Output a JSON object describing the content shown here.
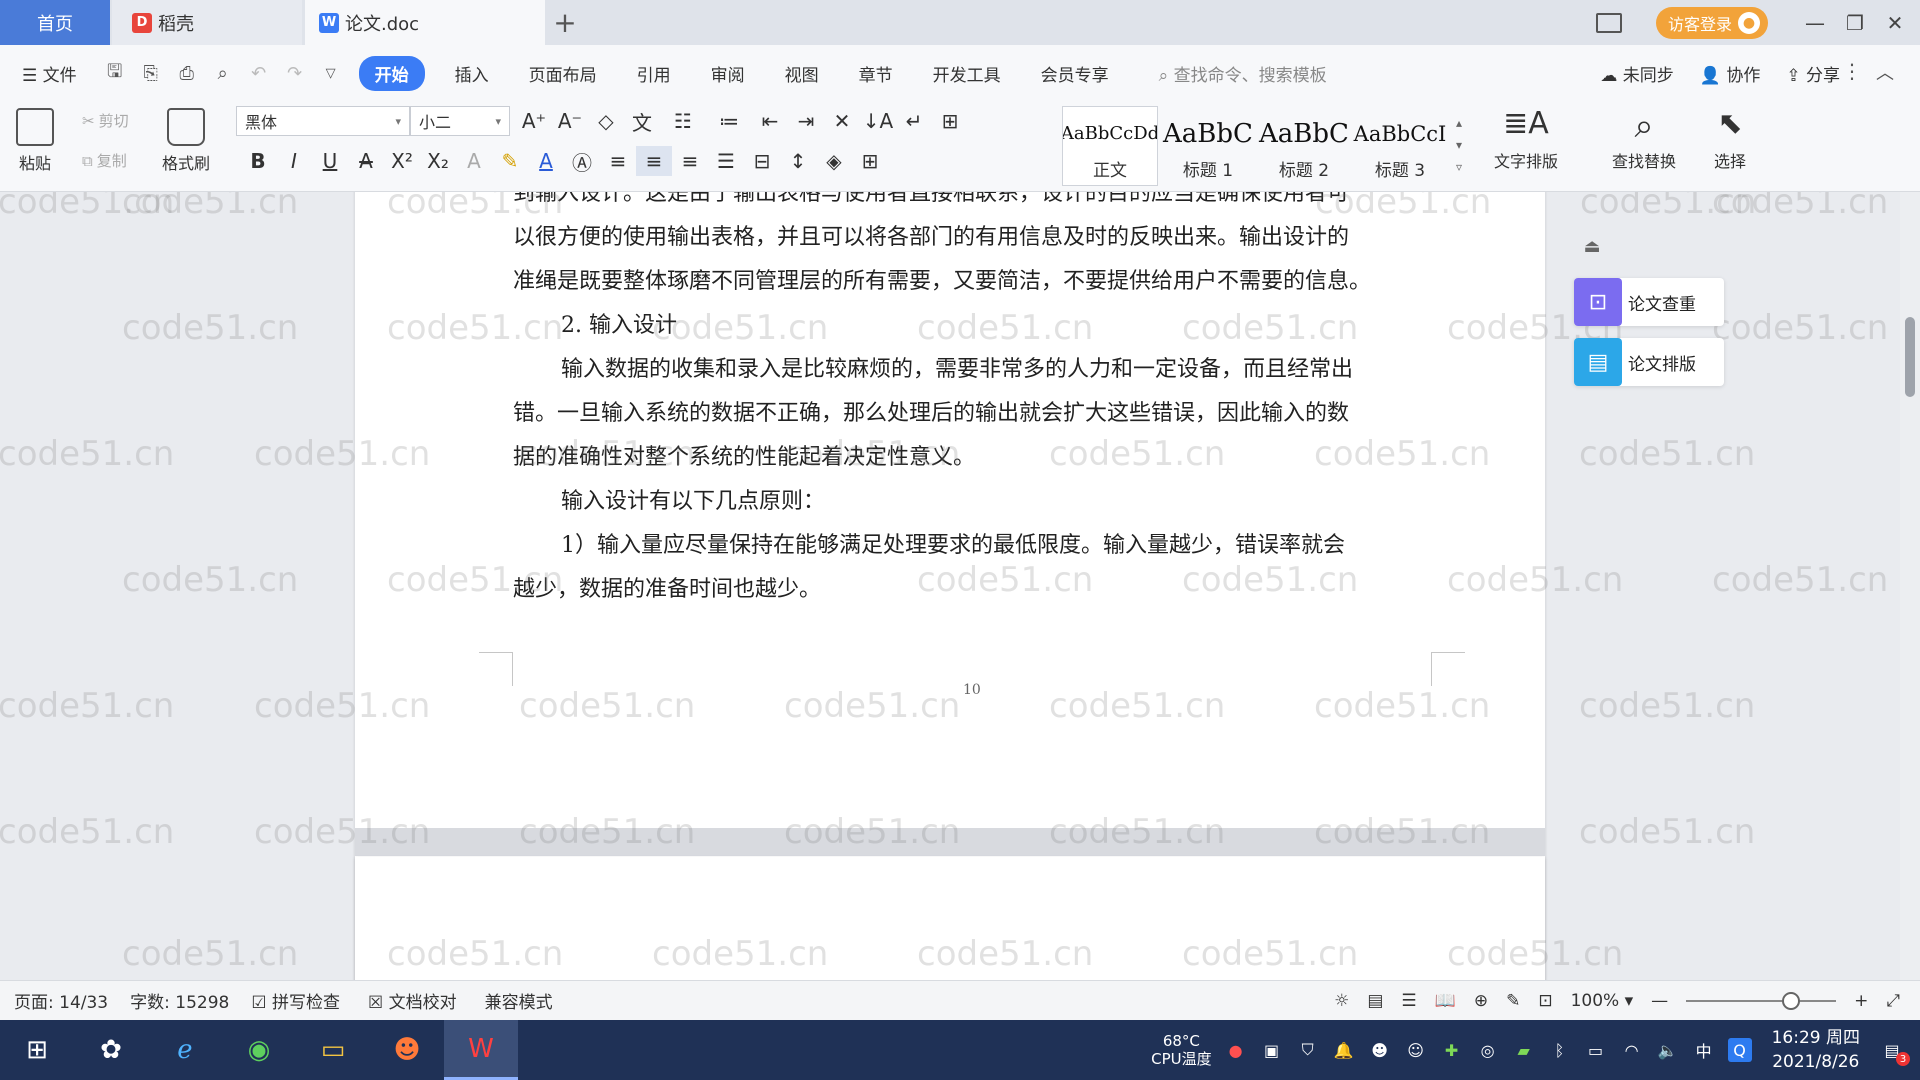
{
  "tabs": {
    "home": "首页",
    "docer": "稻壳",
    "document": "论文.doc"
  },
  "titlebar": {
    "login": "访客登录"
  },
  "menu": {
    "file": "文件",
    "items": [
      "开始",
      "插入",
      "页面布局",
      "引用",
      "审阅",
      "视图",
      "章节",
      "开发工具",
      "会员专享"
    ],
    "search_placeholder": "查找命令、搜索模板",
    "sync": "未同步",
    "collab": "协作",
    "share": "分享"
  },
  "ribbon": {
    "paste": "粘贴",
    "cut": "剪切",
    "copy": "复制",
    "format_painter": "格式刷",
    "font_name": "黑体",
    "font_size": "小二",
    "styles": [
      {
        "preview": "AaBbCcDd",
        "name": "正文"
      },
      {
        "preview": "AaBbC",
        "name": "标题 1"
      },
      {
        "preview": "AaBbC",
        "name": "标题 2"
      },
      {
        "preview": "AaBbCcI",
        "name": "标题 3"
      }
    ],
    "text_layout": "文字排版",
    "find_replace": "查找替换",
    "select": "选择"
  },
  "document": {
    "paragraphs": [
      "到输入设计。这是由于输出表格与使用者直接相联系，设计的目的应当是确保使用者可",
      "以很方便的使用输出表格，并且可以将各部门的有用信息及时的反映出来。输出设计的",
      "准绳是既要整体琢磨不同管理层的所有需要，又要简洁，不要提供给用户不需要的信息。",
      "2. 输入设计",
      "输入数据的收集和录入是比较麻烦的，需要非常多的人力和一定设备，而且经常出",
      "错。一旦输入系统的数据不正确，那么处理后的输出就会扩大这些错误，因此输入的数",
      "据的准确性对整个系统的性能起着决定性意义。",
      "输入设计有以下几点原则：",
      "1）输入量应尽量保持在能够满足处理要求的最低限度。输入量越少，错误率就会",
      "越少，数据的准备时间也越少。"
    ],
    "page_number": "10",
    "watermark": "code51.cn"
  },
  "side_panel": {
    "check": "论文查重",
    "format": "论文排版"
  },
  "statusbar": {
    "page": "页面: 14/33",
    "words": "字数: 15298",
    "spell": "拼写检查",
    "proof": "文档校对",
    "compat": "兼容模式",
    "zoom": "100%"
  },
  "taskbar": {
    "cpu_temp": "68°C",
    "cpu_label": "CPU温度",
    "ime": "中",
    "time": "16:29 周四",
    "date": "2021/8/26",
    "notif_count": "3"
  }
}
